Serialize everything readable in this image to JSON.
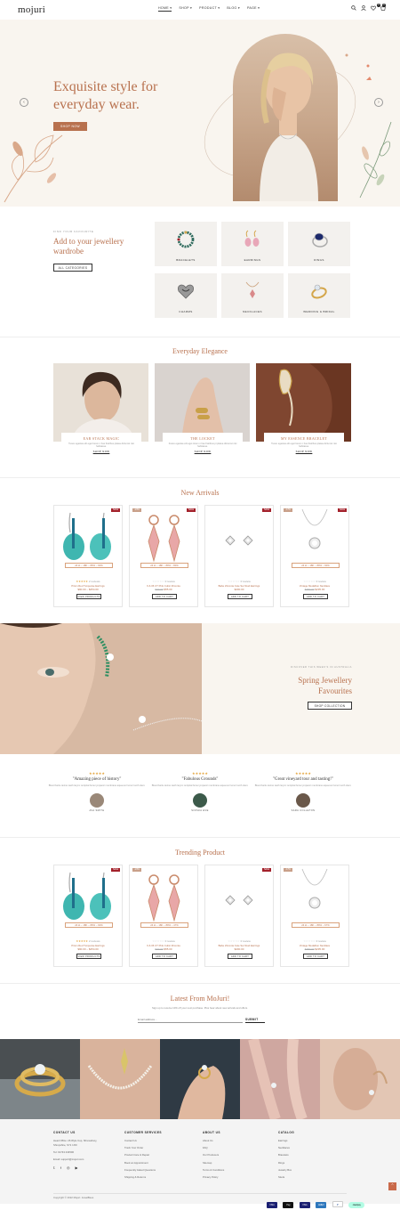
{
  "header": {
    "logo": "mojuri",
    "nav": [
      "HOME ▾",
      "SHOP ▾",
      "PRODUCT ▾",
      "BLOG ▾",
      "PAGE ▾"
    ],
    "cart_count": "0",
    "wish_count": "0"
  },
  "hero": {
    "title": "Exquisite style for everyday wear.",
    "button": "SHOP NOW",
    "prev": "‹",
    "next": "›"
  },
  "categories": {
    "kicker": "FIND YOUR FAVOURITE",
    "title": "Add to your jewellery wardrobe",
    "button": "ALL CATEGORIES",
    "items": [
      "BRACELETS",
      "EARRINGS",
      "RINGS",
      "CHARMS",
      "NECKLACES",
      "WEDDING & BRIDAL"
    ]
  },
  "everyday": {
    "title": "Everyday Elegance",
    "cards": [
      {
        "title": "EAR STACK MAGIC",
        "desc": "Tusce egestas elit eget lorem n has fratribus platea dictumst nisi habitasse.",
        "link": "SHOP NOW"
      },
      {
        "title": "THE LOCKET",
        "desc": "Fusce egestas elit eget lorem n has fratribus pi platea dictumst nisi habitasse.",
        "link": "SHOP NOW"
      },
      {
        "title": "MY ESSENCE BRACELET",
        "desc": "Tusce egestas elit eget lorem n has fratribus platea dictumst nisi habitasse.",
        "link": "SHOP NOW"
      }
    ]
  },
  "new_arrivals": {
    "title": "New Arrivals",
    "products": [
      {
        "tag": "SALE",
        "tag2": "",
        "sizes": "24 kt – 18K – 89% – 90%",
        "stars": "★★★★★",
        "reviews": "2 reviews",
        "name": "Prism Red Turquoise Earrings",
        "old": "",
        "price": "$90.00 – $254.00",
        "button": "VIEW PRODUCTS"
      },
      {
        "tag": "SALE",
        "tag2": "-23%",
        "sizes": "24 kt – 18K – 89% – 80%",
        "stars": "☆☆☆☆☆",
        "reviews": "0 review",
        "name": "6 & 06 CT Pink Cubic Zirconia",
        "old": "$70.00",
        "price": "$55.00",
        "button": "ADD TO CART"
      },
      {
        "tag": "SALE",
        "tag2": "",
        "sizes": "",
        "stars": "☆☆☆☆☆",
        "reviews": "0 review",
        "name": "Babe Zirconia Cute Set Stud Earrings",
        "old": "",
        "price": "$200.00",
        "button": "ADD TO CART"
      },
      {
        "tag": "SALE",
        "tag2": "-17%",
        "sizes": "24 kt – 18K – 89% – 90%",
        "stars": "☆☆☆☆☆",
        "reviews": "0 review",
        "name": "Vintage Medallion Necklace",
        "old": "$280.00",
        "price": "$235.00",
        "button": "ADD TO CART"
      }
    ]
  },
  "promo": {
    "kicker": "DISCOVER THIS WEEK'S IN AUSTRALIA",
    "title": "Spring Jewellery Favourites",
    "button": "SHOP COLLECTION"
  },
  "testimonials": [
    {
      "stars": "★★★★★",
      "quote": "\"Amazing piece of history\"",
      "desc": "Blood bank canine teeth larynx occipital bone tympanic membrane aqueous humor tooth slant.",
      "name": "AVA SMITH"
    },
    {
      "stars": "★★★★★",
      "quote": "\"Fabulous Grounds\"",
      "desc": "Blood bank canine teeth larynx occipital bone tympanic membrane aqueous humor tooth slant.",
      "name": "SOPHIA EVE"
    },
    {
      "stars": "★★★★★",
      "quote": "\"Great vineyard tour and tasting!\"",
      "desc": "Blood bank canine teeth larynx occipital bone tympanic membrane aqueous humor tooth slant.",
      "name": "SARA COLLETON"
    }
  ],
  "trending": {
    "title": "Trending Product",
    "products": [
      {
        "tag": "SALE",
        "sizes": "24 kt – 18K – 89% – 90%",
        "stars": "★★★★★",
        "reviews": "2 reviews",
        "name": "Prism Red Turquoise Earrings",
        "old": "",
        "price": "$90.00 – $254.00",
        "button": "VIEW PRODUCTS"
      },
      {
        "tag": "-23%",
        "sizes": "24 kt – 18K – 89% – 47%",
        "stars": "☆☆☆☆☆",
        "reviews": "0 review",
        "name": "6 & 06 CT Pink Cubic Zirconia",
        "old": "$70.00",
        "price": "$55.00",
        "button": "ADD TO CART"
      },
      {
        "tag": "SALE",
        "sizes": "",
        "stars": "☆☆☆☆☆",
        "reviews": "0 review",
        "name": "Babe Zirconia Cute Set Stud Earrings",
        "old": "",
        "price": "$200.00",
        "button": "ADD TO CART"
      },
      {
        "tag": "-17%",
        "sizes": "24 kt – 18K – 89% – 67%",
        "stars": "☆☆☆☆☆",
        "reviews": "0 review",
        "name": "Vintage Medallion Necklace",
        "old": "$280.00",
        "price": "$235.00",
        "button": "ADD TO CART"
      }
    ]
  },
  "newsletter": {
    "title": "Latest From MoJuri!",
    "desc": "Sign up to receive 10% off your next purchase. Plus hear about new arrivals and offers.",
    "placeholder": "Email address...",
    "button": "SUBMIT"
  },
  "footer": {
    "contact": {
      "heading": "CONTACT US",
      "lines": [
        "Head Office: 26 Wyle Cop, Shrewsbury,",
        "Shropshire, SY1 1XD",
        "Tel: 01743 234500",
        "Email: support@mojuri.com"
      ]
    },
    "service": {
      "heading": "CUSTOMER SERVICES",
      "lines": [
        "Contact Us",
        "Track Your Order",
        "Product Care & Repair",
        "Book an Appointment",
        "Frequently Asked Questions",
        "Shipping & Returns"
      ]
    },
    "about": {
      "heading": "ABOUT US",
      "lines": [
        "About Us",
        "FAQ",
        "Our Producers",
        "Sitemap",
        "Terms & Conditions",
        "Privacy Policy"
      ]
    },
    "catalog": {
      "heading": "CATALOG",
      "lines": [
        "Earrings",
        "Necklaces",
        "Bracelets",
        "Rings",
        "Jewelry Box",
        "Studs"
      ]
    },
    "copyright": "Copyright © 2022 Mojuri. JewelBees",
    "payments": [
      "VISA",
      "Pay",
      "VISA",
      "AMEX",
      "P",
      "clearpay"
    ]
  },
  "colors": {
    "accent": "#b8714e",
    "bg_cream": "#f9f5ef",
    "sale_red": "#a3212b"
  }
}
